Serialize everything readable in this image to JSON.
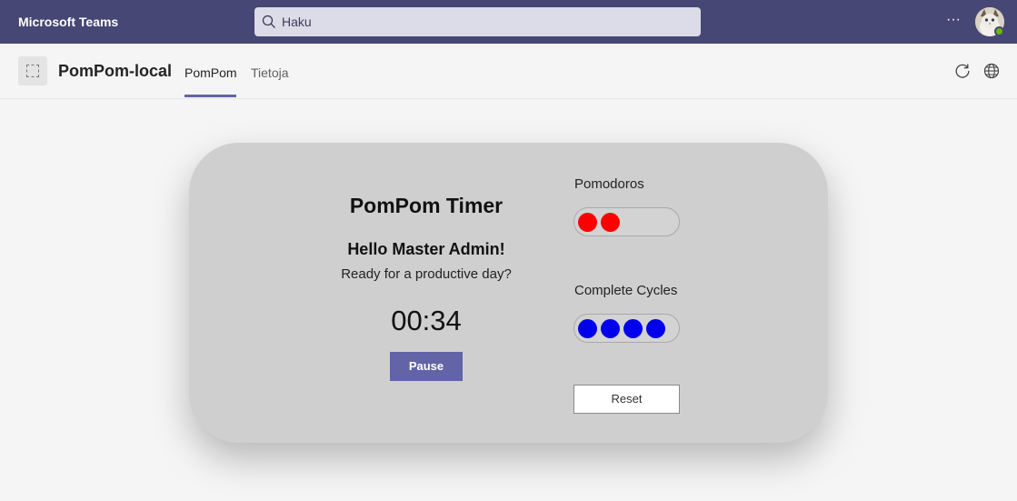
{
  "topbar": {
    "app_title": "Microsoft Teams",
    "search_placeholder": "Haku",
    "more_label": "···"
  },
  "appbar": {
    "app_name": "PomPom-local",
    "tabs": [
      {
        "label": "PomPom",
        "selected": true
      },
      {
        "label": "Tietoja",
        "selected": false
      }
    ]
  },
  "timer": {
    "title": "PomPom Timer",
    "greeting": "Hello Master Admin!",
    "subtitle": "Ready for a productive day?",
    "time": "00:34",
    "pause_label": "Pause"
  },
  "progress": {
    "pomodoros_label": "Pomodoros",
    "pomodoros_count": 2,
    "pomodoro_color": "#ff0000",
    "cycles_label": "Complete Cycles",
    "cycles_count": 4,
    "cycle_color": "#0000ee",
    "reset_label": "Reset"
  },
  "colors": {
    "topbar": "#464775",
    "accent": "#6264a7",
    "card": "#cfcfcf"
  }
}
